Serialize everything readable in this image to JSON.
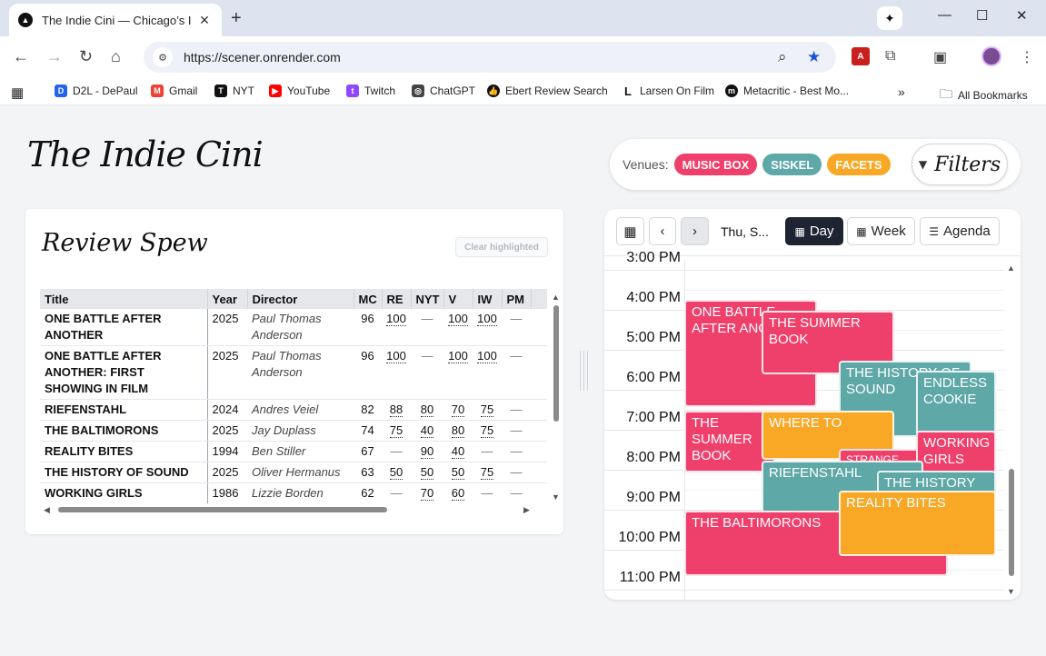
{
  "browser": {
    "tab_title": "The Indie Cini — Chicago’s Indie",
    "url": "https://scener.onrender.com",
    "bookmarks": [
      "D2L - DePaul",
      "Gmail",
      "NYT",
      "YouTube",
      "Twitch",
      "ChatGPT",
      "Ebert Review Search",
      "Larsen On Film",
      "Metacritic - Best Mo..."
    ],
    "all_bookmarks": "All Bookmarks",
    "overflow": "»"
  },
  "header": {
    "logo": "The Indie Cini",
    "venues_label": "Venues:",
    "venues": [
      {
        "label": "MUSIC BOX",
        "color": "#ef3f6b"
      },
      {
        "label": "SISKEL",
        "color": "#5fa8a8"
      },
      {
        "label": "FACETS",
        "color": "#f9a825"
      }
    ],
    "filters_label": "Filters"
  },
  "review": {
    "title": "Review Spew",
    "clear_label": "Clear highlighted",
    "columns": [
      "Title",
      "Year",
      "Director",
      "MC",
      "RE",
      "NYT",
      "V",
      "IW",
      "PM",
      ""
    ],
    "rows": [
      {
        "title": "ONE BATTLE AFTER ANOTHER",
        "year": "2025",
        "director": "Paul Thomas Anderson",
        "mc": "96",
        "re": "100",
        "nyt": "—",
        "v": "100",
        "iw": "100",
        "pm": "—",
        "extra": ""
      },
      {
        "title": "ONE BATTLE AFTER ANOTHER: FIRST SHOWING IN FILM",
        "year": "2025",
        "director": "Paul Thomas Anderson",
        "mc": "96",
        "re": "100",
        "nyt": "—",
        "v": "100",
        "iw": "100",
        "pm": "—",
        "extra": ""
      },
      {
        "title": "RIEFENSTAHL",
        "year": "2024",
        "director": "Andres Veiel",
        "mc": "82",
        "re": "88",
        "nyt": "80",
        "v": "70",
        "iw": "75",
        "pm": "—",
        "extra": ""
      },
      {
        "title": "THE BALTIMORONS",
        "year": "2025",
        "director": "Jay Duplass",
        "mc": "74",
        "re": "75",
        "nyt": "40",
        "v": "80",
        "iw": "75",
        "pm": "—",
        "extra": ""
      },
      {
        "title": "REALITY BITES",
        "year": "1994",
        "director": "Ben Stiller",
        "mc": "67",
        "re": "—",
        "nyt": "90",
        "v": "40",
        "iw": "—",
        "pm": "—",
        "extra": ""
      },
      {
        "title": "THE HISTORY OF SOUND",
        "year": "2025",
        "director": "Oliver Hermanus",
        "mc": "63",
        "re": "50",
        "nyt": "50",
        "v": "50",
        "iw": "75",
        "pm": "—",
        "extra": ""
      },
      {
        "title": "WORKING GIRLS",
        "year": "1986",
        "director": "Lizzie Borden",
        "mc": "62",
        "re": "—",
        "nyt": "70",
        "v": "60",
        "iw": "—",
        "pm": "—",
        "extra": ""
      }
    ]
  },
  "calendar": {
    "date_label": "Thu, S...",
    "views": [
      "Day",
      "Week",
      "Agenda"
    ],
    "active_view": "Day",
    "hours": [
      "3:00 PM",
      "4:00 PM",
      "5:00 PM",
      "6:00 PM",
      "7:00 PM",
      "8:00 PM",
      "9:00 PM",
      "10:00 PM",
      "11:00 PM"
    ],
    "events": [
      {
        "title": "ONE BATTLE AFTER ANOTHER",
        "venue": "MUSIC BOX",
        "color": "pink"
      },
      {
        "title": "THE SUMMER BOOK",
        "venue": "MUSIC BOX",
        "color": "pink"
      },
      {
        "title": "THE HISTORY OF SOUND",
        "venue": "SISKEL",
        "color": "teal"
      },
      {
        "title": "ENDLESS COOKIE",
        "venue": "SISKEL",
        "color": "teal"
      },
      {
        "title": "THE SUMMER BOOK",
        "venue": "MUSIC BOX",
        "color": "pink"
      },
      {
        "title": "WHERE TO",
        "venue": "FACETS",
        "color": "orange"
      },
      {
        "title": "STRANGE",
        "venue": "MUSIC BOX",
        "color": "pink"
      },
      {
        "title": "WORKING GIRLS",
        "venue": "MUSIC BOX",
        "color": "pink"
      },
      {
        "title": "RIEFENSTAHL",
        "venue": "SISKEL",
        "color": "teal"
      },
      {
        "title": "THE HISTORY",
        "venue": "SISKEL",
        "color": "teal"
      },
      {
        "title": "THE BALTIMORONS",
        "venue": "MUSIC BOX",
        "color": "pink"
      },
      {
        "title": "REALITY BITES",
        "venue": "FACETS",
        "color": "orange"
      }
    ]
  }
}
